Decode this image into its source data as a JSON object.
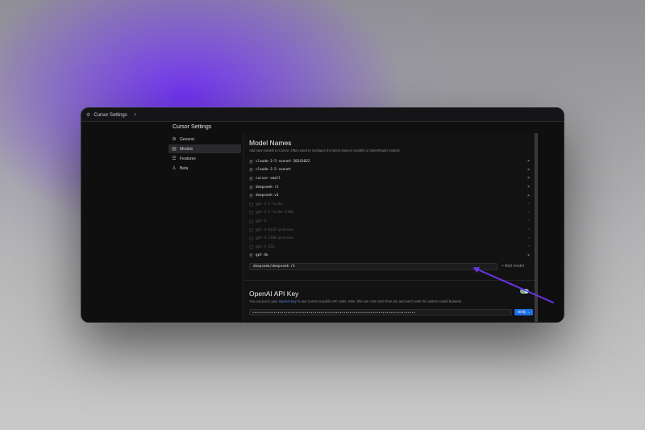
{
  "window": {
    "tab_icon": "gear-icon",
    "tab_title": "Cursor Settings",
    "tab_close": "×"
  },
  "settings_title": "Cursor Settings",
  "sidebar": {
    "items": [
      {
        "label": "General",
        "icon": "gear-icon",
        "glyph": "⚙",
        "active": false
      },
      {
        "label": "Models",
        "icon": "grid-icon",
        "glyph": "▤",
        "active": true
      },
      {
        "label": "Features",
        "icon": "sliders-icon",
        "glyph": "☰",
        "active": false
      },
      {
        "label": "Beta",
        "icon": "user-icon",
        "glyph": "♙",
        "active": false
      }
    ]
  },
  "model_names": {
    "title": "Model Names",
    "description": "Add new models to Cursor. Often used to configure the latest OpenAI models or OpenRouter models.",
    "models": [
      {
        "name": "claude-3-5-sonnet-20241022",
        "enabled": true
      },
      {
        "name": "claude-3.5-sonnet",
        "enabled": true
      },
      {
        "name": "cursor-small",
        "enabled": true
      },
      {
        "name": "deepseek-r1",
        "enabled": true
      },
      {
        "name": "deepseek-v3",
        "enabled": true
      },
      {
        "name": "gpt-3.5-turbo",
        "enabled": false
      },
      {
        "name": "gpt-3.5-turbo-1106",
        "enabled": false
      },
      {
        "name": "gpt-4",
        "enabled": false
      },
      {
        "name": "gpt-4-0125-preview",
        "enabled": false
      },
      {
        "name": "gpt-4-1106-preview",
        "enabled": false
      },
      {
        "name": "gpt-4-32k",
        "enabled": false
      },
      {
        "name": "gpt-4o",
        "enabled": true
      }
    ],
    "remove_glyph": "×",
    "check_glyph": "✓",
    "new_model_value": "deepseek/deepseek-r1",
    "add_model_label": "+ Add model"
  },
  "openai": {
    "title": "OpenAI API Key",
    "description_prefix": "You can put in your ",
    "description_link": "OpenAI key",
    "description_suffix": " to use Cursor at public API costs. Note: this can cost more than pro and won't work for custom model features.",
    "key_value": "••••••••••••••••••••••••••••••••••••••••••••••••••••••••••••••••••••••••••••••••••••",
    "toggle_on": true,
    "verify_label": "Verify →"
  },
  "colors": {
    "accent_blue": "#1f6fe0",
    "toggle_green": "#7db58a",
    "arrow_purple": "#6a35e0"
  }
}
